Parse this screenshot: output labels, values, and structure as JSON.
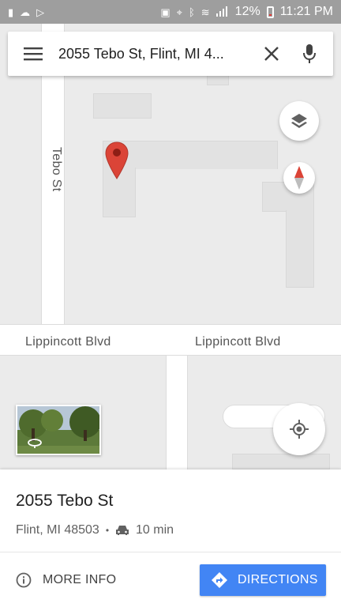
{
  "status_bar": {
    "left_icons": [
      "notification-icon",
      "cloud-icon",
      "play-icon"
    ],
    "battery_percent": "12%",
    "time": "11:21 PM"
  },
  "search": {
    "query": "2055 Tebo St, Flint, MI 4..."
  },
  "map": {
    "street_labels": {
      "tebo": "Tebo St",
      "lippincott_left": "Lippincott Blvd",
      "lippincott_right": "Lippincott Blvd"
    }
  },
  "place": {
    "title": "2055 Tebo St",
    "city": "Flint, MI 48503",
    "separator": "•",
    "drive_time": "10 min"
  },
  "actions": {
    "more_info": "MORE INFO",
    "directions": "DIRECTIONS"
  },
  "colors": {
    "accent": "#4285f4",
    "pin": "#db4437",
    "status_bar": "#9e9e9e"
  }
}
